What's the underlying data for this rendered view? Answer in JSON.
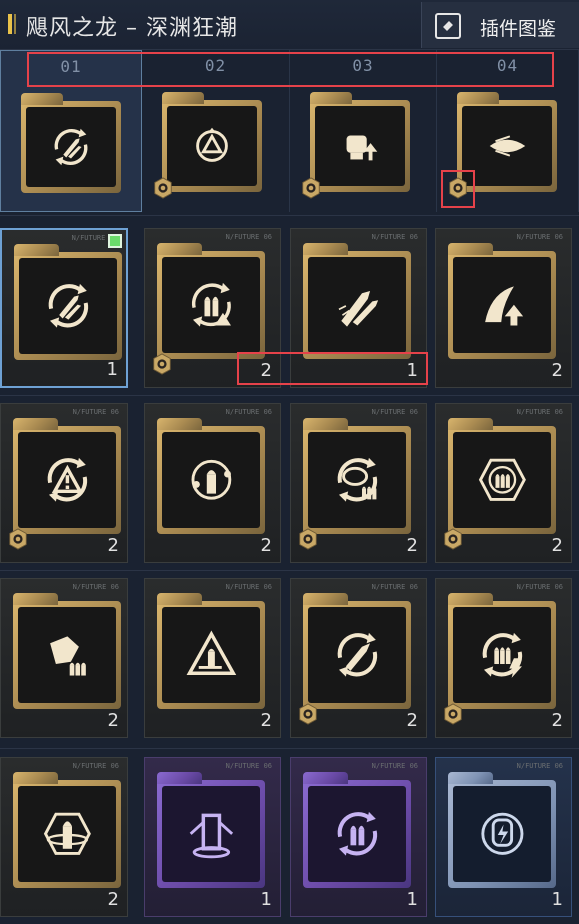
{
  "header": {
    "title": "飓风之龙 – 深渊狂潮",
    "plugin_button_label": "插件图鉴",
    "plugin_icon": "card-gallery-icon"
  },
  "slots": [
    {
      "num": "01",
      "icon": "rocket-cycle-icon",
      "active": true,
      "gear": false
    },
    {
      "num": "02",
      "icon": "triangle-cycle-icon",
      "active": false,
      "gear": true
    },
    {
      "num": "03",
      "icon": "fist-up-icon",
      "active": false,
      "gear": true
    },
    {
      "num": "04",
      "icon": "feather-bullet-icon",
      "active": false,
      "gear": true
    }
  ],
  "card_tag": "N/FUTURE 06",
  "grid": [
    {
      "icon": "rocket-cycle-icon",
      "count": "1",
      "variant": "gold",
      "gear": false,
      "selected": true,
      "green": true
    },
    {
      "icon": "ammo-warning-icon",
      "count": "2",
      "variant": "gold",
      "gear": true,
      "selected": false,
      "green": false
    },
    {
      "icon": "twin-bullet-icon",
      "count": "1",
      "variant": "gold",
      "gear": false,
      "selected": false,
      "green": false
    },
    {
      "icon": "feather-up-icon",
      "count": "2",
      "variant": "gold",
      "gear": false,
      "selected": false,
      "green": false
    },
    {
      "icon": "warning-cycle-icon",
      "count": "2",
      "variant": "gold",
      "gear": true,
      "selected": false,
      "green": false
    },
    {
      "icon": "bullet-orbit-icon",
      "count": "2",
      "variant": "gold",
      "gear": false,
      "selected": false,
      "green": false
    },
    {
      "icon": "brain-ammo-icon",
      "count": "2",
      "variant": "gold",
      "gear": true,
      "selected": false,
      "green": false
    },
    {
      "icon": "target-ammo-icon",
      "count": "2",
      "variant": "gold",
      "gear": true,
      "selected": false,
      "green": false
    },
    {
      "icon": "shatter-ammo-icon",
      "count": "2",
      "variant": "gold",
      "gear": false,
      "selected": false,
      "green": false
    },
    {
      "icon": "triangle-bullet-icon",
      "count": "2",
      "variant": "gold",
      "gear": false,
      "selected": false,
      "green": false
    },
    {
      "icon": "bullet-cycle-icon",
      "count": "2",
      "variant": "gold",
      "gear": true,
      "selected": false,
      "green": false
    },
    {
      "icon": "ammo-bolt-icon",
      "count": "2",
      "variant": "gold",
      "gear": true,
      "selected": false,
      "green": false
    },
    {
      "icon": "bullet-hex-icon",
      "count": "2",
      "variant": "gold",
      "gear": false,
      "selected": false,
      "green": false
    },
    {
      "icon": "pillar-icon",
      "count": "1",
      "variant": "purple",
      "gear": false,
      "selected": false,
      "green": false
    },
    {
      "icon": "ammo-swap-icon",
      "count": "1",
      "variant": "purple",
      "gear": false,
      "selected": false,
      "green": false
    },
    {
      "icon": "hand-bolt-icon",
      "count": "1",
      "variant": "blue",
      "gear": false,
      "selected": false,
      "green": false
    }
  ],
  "colors": {
    "background": "#1a2231",
    "gold": "#d9b56d",
    "purple": "#8a6ad0",
    "blue": "#7f93b4",
    "highlight_red": "#e6424a",
    "selected_border": "#6ea1d4",
    "green_marker": "#6bdc6b"
  }
}
